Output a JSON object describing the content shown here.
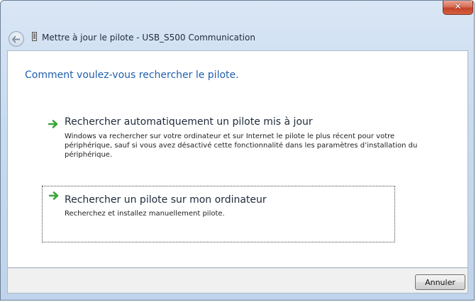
{
  "window": {
    "title": "Mettre à jour le pilote - USB_S500 Communication",
    "close_glyph": "✕"
  },
  "content": {
    "heading": "Comment voulez-vous rechercher le pilote.",
    "options": [
      {
        "title": "Rechercher automatiquement un pilote mis à jour",
        "description": "Windows va rechercher sur votre ordinateur et sur Internet le pilote le plus récent pour votre périphérique, sauf si vous avez désactivé cette fonctionnalité dans les paramètres d’installation du périphérique.",
        "icon": "green-arrow-icon"
      },
      {
        "title": "Rechercher un pilote sur mon ordinateur",
        "description": "Recherchez et installez manuellement pilote.",
        "icon": "green-arrow-icon"
      }
    ]
  },
  "footer": {
    "cancel_label": "Annuler"
  },
  "colors": {
    "heading": "#1f5fae",
    "arrow": "#3aa53a",
    "close": "#c4442a"
  }
}
